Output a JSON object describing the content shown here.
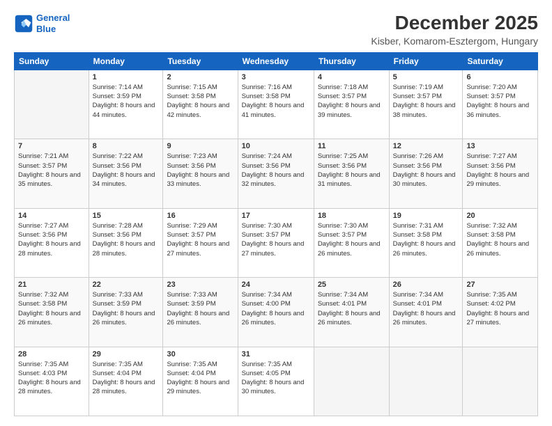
{
  "logo": {
    "line1": "General",
    "line2": "Blue"
  },
  "title": "December 2025",
  "subtitle": "Kisber, Komarom-Esztergom, Hungary",
  "weekdays": [
    "Sunday",
    "Monday",
    "Tuesday",
    "Wednesday",
    "Thursday",
    "Friday",
    "Saturday"
  ],
  "weeks": [
    [
      {
        "day": "",
        "sunrise": "",
        "sunset": "",
        "daylight": "",
        "empty": true
      },
      {
        "day": "1",
        "sunrise": "Sunrise: 7:14 AM",
        "sunset": "Sunset: 3:59 PM",
        "daylight": "Daylight: 8 hours and 44 minutes."
      },
      {
        "day": "2",
        "sunrise": "Sunrise: 7:15 AM",
        "sunset": "Sunset: 3:58 PM",
        "daylight": "Daylight: 8 hours and 42 minutes."
      },
      {
        "day": "3",
        "sunrise": "Sunrise: 7:16 AM",
        "sunset": "Sunset: 3:58 PM",
        "daylight": "Daylight: 8 hours and 41 minutes."
      },
      {
        "day": "4",
        "sunrise": "Sunrise: 7:18 AM",
        "sunset": "Sunset: 3:57 PM",
        "daylight": "Daylight: 8 hours and 39 minutes."
      },
      {
        "day": "5",
        "sunrise": "Sunrise: 7:19 AM",
        "sunset": "Sunset: 3:57 PM",
        "daylight": "Daylight: 8 hours and 38 minutes."
      },
      {
        "day": "6",
        "sunrise": "Sunrise: 7:20 AM",
        "sunset": "Sunset: 3:57 PM",
        "daylight": "Daylight: 8 hours and 36 minutes."
      }
    ],
    [
      {
        "day": "7",
        "sunrise": "Sunrise: 7:21 AM",
        "sunset": "Sunset: 3:57 PM",
        "daylight": "Daylight: 8 hours and 35 minutes."
      },
      {
        "day": "8",
        "sunrise": "Sunrise: 7:22 AM",
        "sunset": "Sunset: 3:56 PM",
        "daylight": "Daylight: 8 hours and 34 minutes."
      },
      {
        "day": "9",
        "sunrise": "Sunrise: 7:23 AM",
        "sunset": "Sunset: 3:56 PM",
        "daylight": "Daylight: 8 hours and 33 minutes."
      },
      {
        "day": "10",
        "sunrise": "Sunrise: 7:24 AM",
        "sunset": "Sunset: 3:56 PM",
        "daylight": "Daylight: 8 hours and 32 minutes."
      },
      {
        "day": "11",
        "sunrise": "Sunrise: 7:25 AM",
        "sunset": "Sunset: 3:56 PM",
        "daylight": "Daylight: 8 hours and 31 minutes."
      },
      {
        "day": "12",
        "sunrise": "Sunrise: 7:26 AM",
        "sunset": "Sunset: 3:56 PM",
        "daylight": "Daylight: 8 hours and 30 minutes."
      },
      {
        "day": "13",
        "sunrise": "Sunrise: 7:27 AM",
        "sunset": "Sunset: 3:56 PM",
        "daylight": "Daylight: 8 hours and 29 minutes."
      }
    ],
    [
      {
        "day": "14",
        "sunrise": "Sunrise: 7:27 AM",
        "sunset": "Sunset: 3:56 PM",
        "daylight": "Daylight: 8 hours and 28 minutes."
      },
      {
        "day": "15",
        "sunrise": "Sunrise: 7:28 AM",
        "sunset": "Sunset: 3:56 PM",
        "daylight": "Daylight: 8 hours and 28 minutes."
      },
      {
        "day": "16",
        "sunrise": "Sunrise: 7:29 AM",
        "sunset": "Sunset: 3:57 PM",
        "daylight": "Daylight: 8 hours and 27 minutes."
      },
      {
        "day": "17",
        "sunrise": "Sunrise: 7:30 AM",
        "sunset": "Sunset: 3:57 PM",
        "daylight": "Daylight: 8 hours and 27 minutes."
      },
      {
        "day": "18",
        "sunrise": "Sunrise: 7:30 AM",
        "sunset": "Sunset: 3:57 PM",
        "daylight": "Daylight: 8 hours and 26 minutes."
      },
      {
        "day": "19",
        "sunrise": "Sunrise: 7:31 AM",
        "sunset": "Sunset: 3:58 PM",
        "daylight": "Daylight: 8 hours and 26 minutes."
      },
      {
        "day": "20",
        "sunrise": "Sunrise: 7:32 AM",
        "sunset": "Sunset: 3:58 PM",
        "daylight": "Daylight: 8 hours and 26 minutes."
      }
    ],
    [
      {
        "day": "21",
        "sunrise": "Sunrise: 7:32 AM",
        "sunset": "Sunset: 3:58 PM",
        "daylight": "Daylight: 8 hours and 26 minutes."
      },
      {
        "day": "22",
        "sunrise": "Sunrise: 7:33 AM",
        "sunset": "Sunset: 3:59 PM",
        "daylight": "Daylight: 8 hours and 26 minutes."
      },
      {
        "day": "23",
        "sunrise": "Sunrise: 7:33 AM",
        "sunset": "Sunset: 3:59 PM",
        "daylight": "Daylight: 8 hours and 26 minutes."
      },
      {
        "day": "24",
        "sunrise": "Sunrise: 7:34 AM",
        "sunset": "Sunset: 4:00 PM",
        "daylight": "Daylight: 8 hours and 26 minutes."
      },
      {
        "day": "25",
        "sunrise": "Sunrise: 7:34 AM",
        "sunset": "Sunset: 4:01 PM",
        "daylight": "Daylight: 8 hours and 26 minutes."
      },
      {
        "day": "26",
        "sunrise": "Sunrise: 7:34 AM",
        "sunset": "Sunset: 4:01 PM",
        "daylight": "Daylight: 8 hours and 26 minutes."
      },
      {
        "day": "27",
        "sunrise": "Sunrise: 7:35 AM",
        "sunset": "Sunset: 4:02 PM",
        "daylight": "Daylight: 8 hours and 27 minutes."
      }
    ],
    [
      {
        "day": "28",
        "sunrise": "Sunrise: 7:35 AM",
        "sunset": "Sunset: 4:03 PM",
        "daylight": "Daylight: 8 hours and 28 minutes."
      },
      {
        "day": "29",
        "sunrise": "Sunrise: 7:35 AM",
        "sunset": "Sunset: 4:04 PM",
        "daylight": "Daylight: 8 hours and 28 minutes."
      },
      {
        "day": "30",
        "sunrise": "Sunrise: 7:35 AM",
        "sunset": "Sunset: 4:04 PM",
        "daylight": "Daylight: 8 hours and 29 minutes."
      },
      {
        "day": "31",
        "sunrise": "Sunrise: 7:35 AM",
        "sunset": "Sunset: 4:05 PM",
        "daylight": "Daylight: 8 hours and 30 minutes."
      },
      {
        "day": "",
        "sunrise": "",
        "sunset": "",
        "daylight": "",
        "empty": true
      },
      {
        "day": "",
        "sunrise": "",
        "sunset": "",
        "daylight": "",
        "empty": true
      },
      {
        "day": "",
        "sunrise": "",
        "sunset": "",
        "daylight": "",
        "empty": true
      }
    ]
  ]
}
